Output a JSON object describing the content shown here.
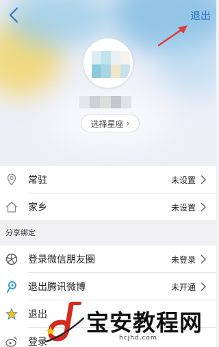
{
  "header": {
    "logout_label": "退出",
    "constellation_button": "选择星座"
  },
  "rows": [
    {
      "label": "常驻",
      "value": "未设置",
      "icon": "location-pin-icon"
    },
    {
      "label": "家乡",
      "value": "未设置",
      "icon": "home-icon"
    }
  ],
  "share_section": {
    "title": "分享绑定",
    "items": [
      {
        "label": "登录微信朋友圈",
        "value": "未登录",
        "icon": "wechat-moments-icon"
      },
      {
        "label": "退出腾讯微博",
        "value": "未开通",
        "icon": "tencent-weibo-icon"
      },
      {
        "label": "退出",
        "value": "",
        "icon": "qzone-star-icon"
      },
      {
        "label": "登录",
        "value": "",
        "icon": "sina-weibo-icon"
      }
    ]
  },
  "watermark": {
    "brand": "宝安教程网",
    "url": "hcjhd.com"
  },
  "colors": {
    "accent": "#2c76c7",
    "annotation_arrow": "#e03a3a"
  }
}
